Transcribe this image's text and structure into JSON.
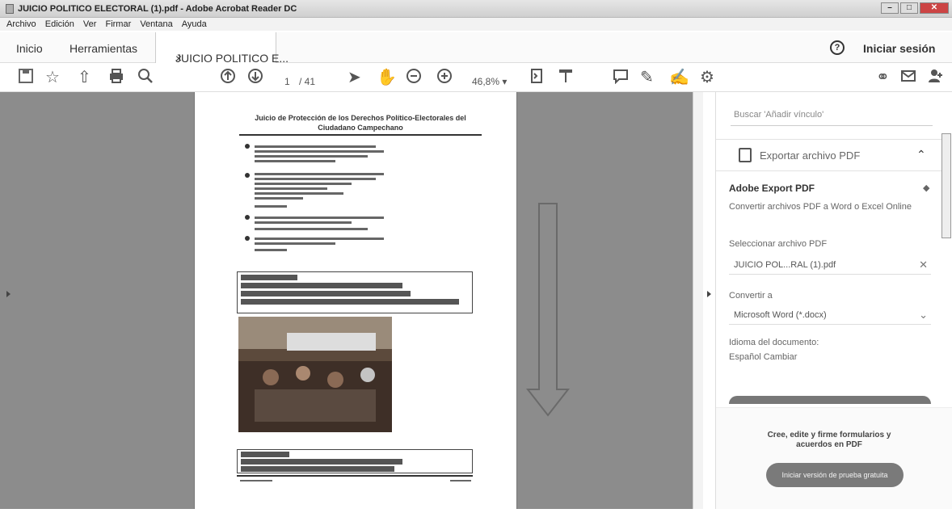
{
  "window": {
    "title": "JUICIO POLITICO ELECTORAL (1).pdf - Adobe Acrobat Reader DC"
  },
  "menu": [
    "Archivo",
    "Edición",
    "Ver",
    "Firmar",
    "Ventana",
    "Ayuda"
  ],
  "tabs": {
    "home": "Inicio",
    "tools": "Herramientas",
    "document": "JUICIO POLITICO E...",
    "sign_in": "Iniciar sesión"
  },
  "toolbar": {
    "page_current": "1",
    "page_total": "/ 41",
    "zoom": "46,8%",
    "icons": [
      "save-icon",
      "bookmark-star-icon",
      "upload-icon",
      "print-icon",
      "search-icon",
      "page-up-icon",
      "page-down-icon",
      "select-cursor-icon",
      "hand-icon",
      "zoom-out-icon",
      "zoom-in-icon",
      "page-fit-icon",
      "scroll-mode-icon",
      "comment-icon",
      "pen-icon",
      "sign-icon",
      "more-tools-icon",
      "share-link-icon",
      "email-icon",
      "add-user-icon"
    ]
  },
  "document": {
    "heading": "Juicio de Protección de los Derechos Político-Electorales del Ciudadano Campechano"
  },
  "right_panel": {
    "search_placeholder": "Buscar 'Añadir vínculo'",
    "export_header": "Exportar archivo PDF",
    "adobe_export_title": "Adobe Export PDF",
    "adobe_export_desc": "Convertir archivos PDF a Word o Excel Online",
    "select_file_label": "Seleccionar archivo PDF",
    "selected_file": "JUICIO POL...RAL (1).pdf",
    "convert_to_label": "Convertir a",
    "convert_to_value": "Microsoft Word (*.docx)",
    "doc_language_label": "Idioma del documento:",
    "doc_language_value": "Español  Cambiar",
    "promo_text": "Cree, edite y firme formularios y acuerdos en PDF",
    "trial_button": "Iniciar versión de prueba gratuita"
  }
}
